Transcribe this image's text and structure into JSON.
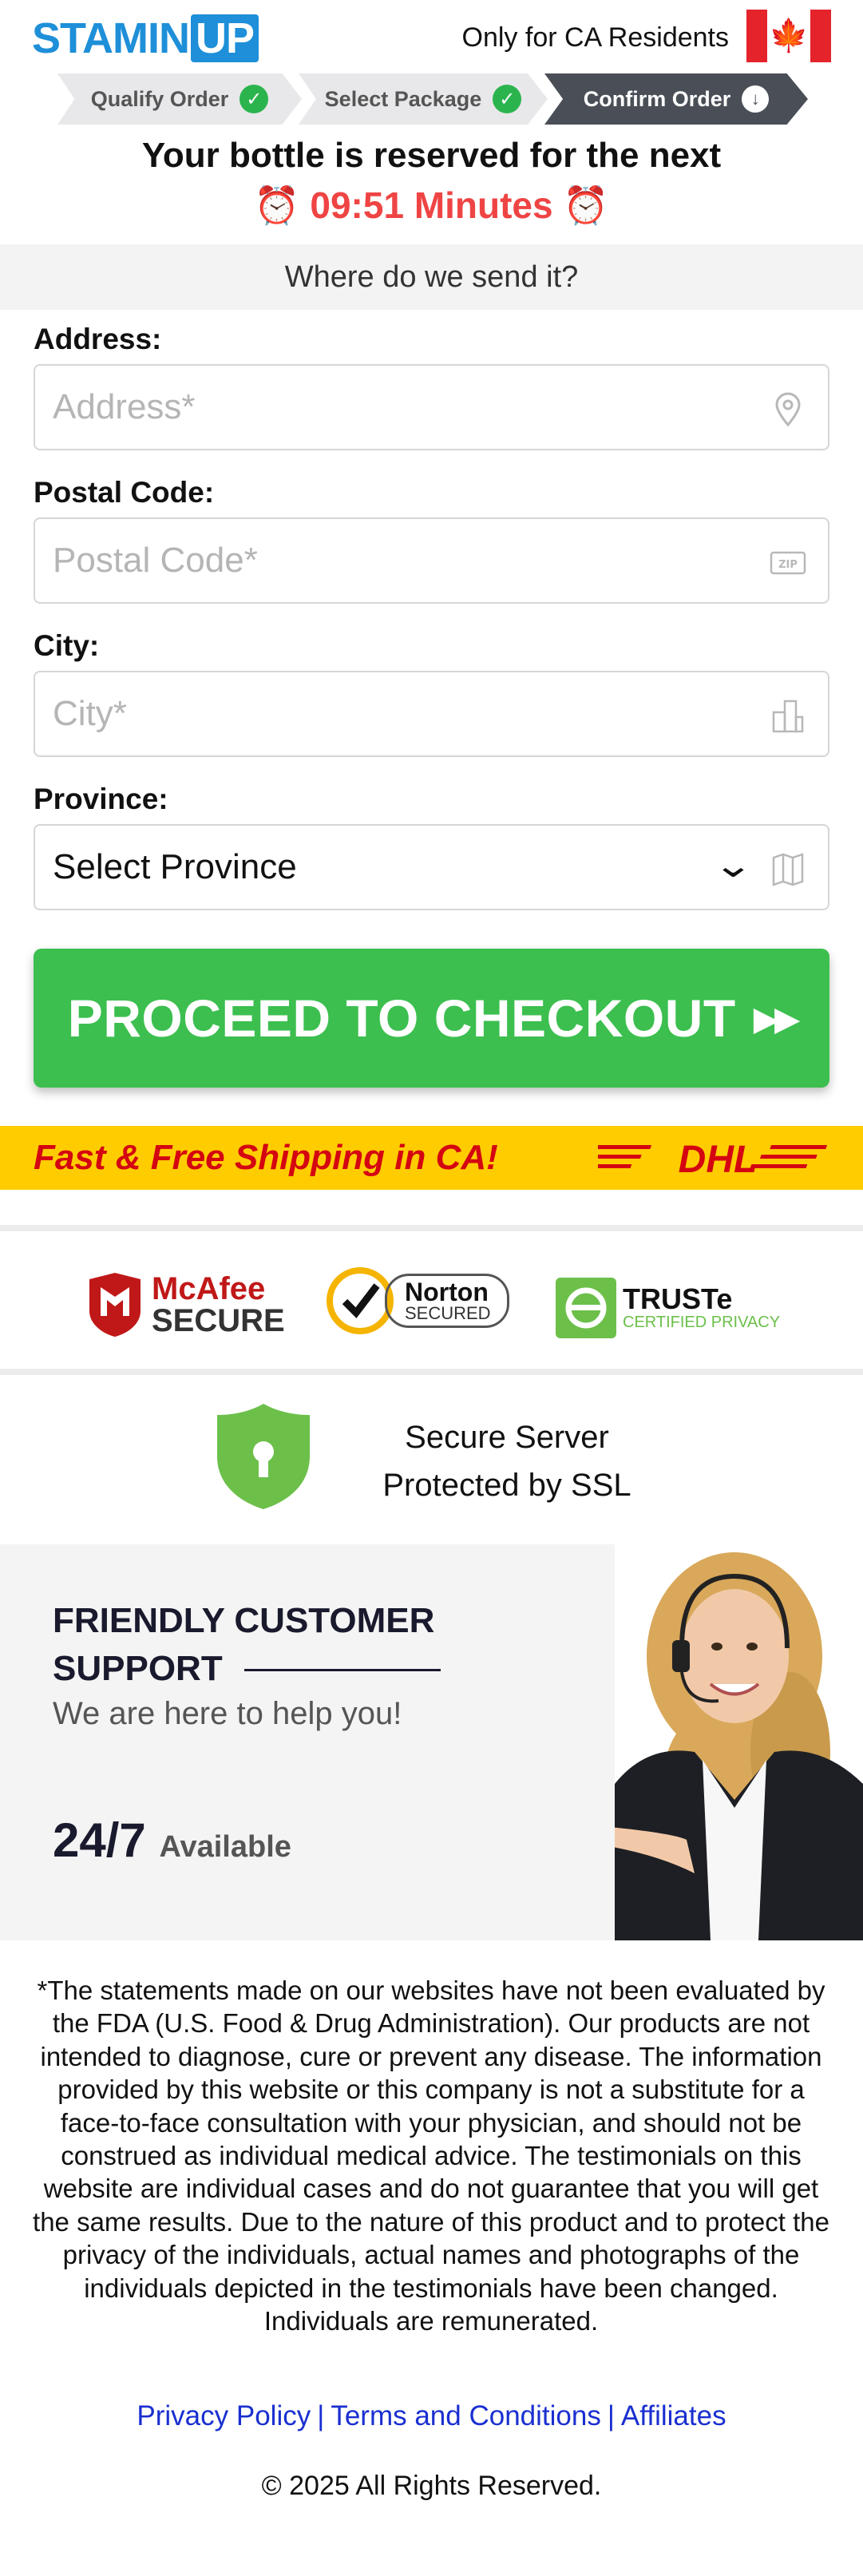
{
  "header": {
    "logo_main": "STAMIN",
    "logo_accent": "UP",
    "region_text": "Only for CA Residents",
    "flag_symbol": "🍁"
  },
  "steps": [
    {
      "label": "Qualify Order",
      "status": "done"
    },
    {
      "label": "Select Package",
      "status": "done"
    },
    {
      "label": "Confirm Order",
      "status": "current"
    }
  ],
  "reservation": {
    "headline": "Your bottle is reserved for the next",
    "timer": "⏰ 09:51 Minutes ⏰"
  },
  "section_title": "Where do we send it?",
  "form": {
    "address": {
      "label": "Address:",
      "placeholder": "Address*",
      "value": ""
    },
    "postal": {
      "label": "Postal Code:",
      "placeholder": "Postal Code*",
      "value": ""
    },
    "city": {
      "label": "City:",
      "placeholder": "City*",
      "value": ""
    },
    "province": {
      "label": "Province:",
      "selected": "Select Province"
    }
  },
  "checkout": {
    "label": "PROCEED TO CHECKOUT",
    "arrows": "▶▶"
  },
  "shipping": {
    "text": "Fast & Free Shipping in CA!",
    "carrier": "DHL"
  },
  "trust": {
    "mcafee": {
      "line1": "McAfee",
      "line2": "SECURE"
    },
    "norton": {
      "line1": "Norton",
      "line2": "SECURED"
    },
    "truste": {
      "line1": "TRUSTe",
      "line2": "CERTIFIED PRIVACY"
    }
  },
  "ssl": {
    "line1": "Secure Server",
    "line2": "Protected by SSL"
  },
  "support": {
    "title": "FRIENDLY CUSTOMER SUPPORT",
    "subtitle": "We are here to help you!",
    "hours": "24/7",
    "hours_suffix": "Available"
  },
  "disclaimer": "*The statements made on our websites have not been evaluated by the FDA (U.S. Food & Drug Administration). Our products are not intended to diagnose, cure or prevent any disease. The information provided by this website or this company is not a substitute for a face-to-face consultation with your physician, and should not be construed as individual medical advice. The testimonials on this website are individual cases and do not guarantee that you will get the same results. Due to the nature of this product and to protect the privacy of the individuals, actual names and photographs of the individuals depicted in the testimonials have been changed. Individuals are remunerated.",
  "footer": {
    "links": [
      "Privacy Policy",
      "Terms and Conditions",
      "Affiliates"
    ],
    "separator": "|",
    "copyright": "© 2025 All Rights Reserved."
  },
  "colors": {
    "brand": "#1e8fd8",
    "cta": "#3cbf4f",
    "timer": "#ef4444",
    "shipping_bg": "#ffcc00",
    "shipping_text": "#d40511",
    "link": "#1a2fd0"
  },
  "icons": {
    "address": "location-pin-icon",
    "postal": "zip-icon",
    "city": "building-icon",
    "province": "map-icon"
  }
}
